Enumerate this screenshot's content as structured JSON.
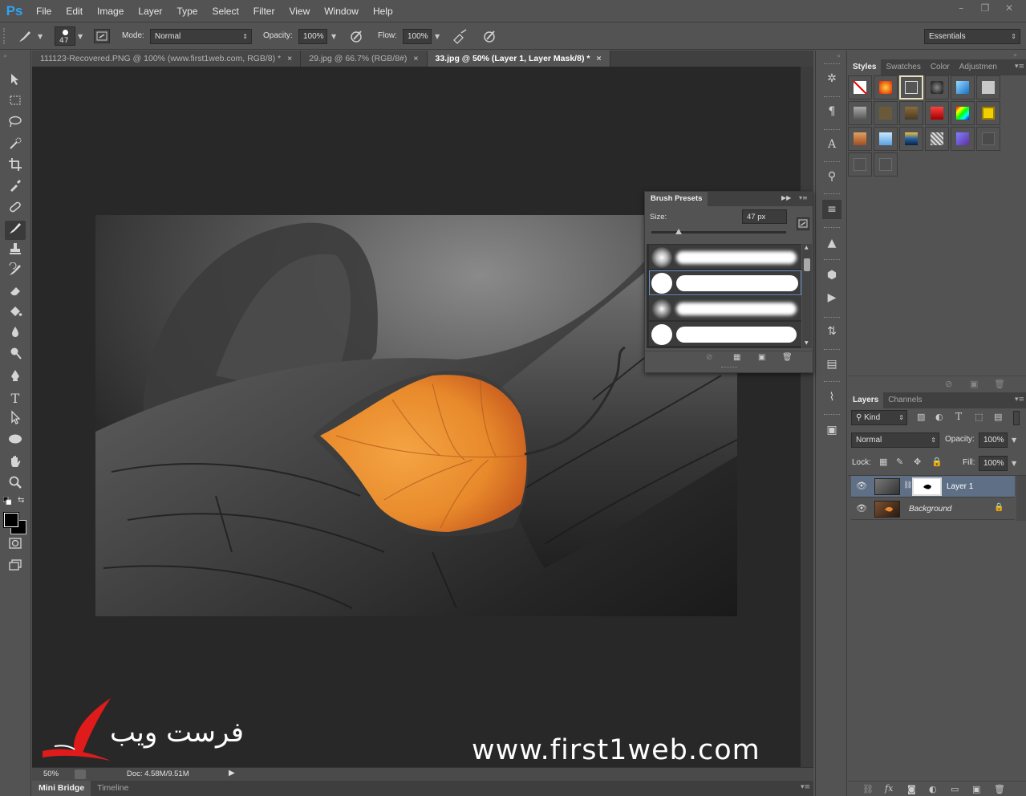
{
  "app": {
    "logo": "Ps",
    "menu": [
      "File",
      "Edit",
      "Image",
      "Layer",
      "Type",
      "Select",
      "Filter",
      "View",
      "Window",
      "Help"
    ],
    "window_controls": [
      "–",
      "❐",
      "✕"
    ]
  },
  "options_bar": {
    "brush_size": "47",
    "mode_label": "Mode:",
    "mode_value": "Normal",
    "opacity_label": "Opacity:",
    "opacity_value": "100%",
    "flow_label": "Flow:",
    "flow_value": "100%",
    "workspace": "Essentials"
  },
  "documents": {
    "tabs": [
      {
        "label": "111123-Recovered.PNG @ 100% (www.first1web.com, RGB/8) *",
        "close": "×"
      },
      {
        "label": "29.jpg @ 66.7% (RGB/8#)",
        "close": "×"
      },
      {
        "label": "33.jpg @ 50% (Layer 1, Layer Mask/8) *",
        "close": "×"
      }
    ]
  },
  "status_bar": {
    "zoom": "50%",
    "doc_info": "Doc: 4.58M/9.51M"
  },
  "bottom_panel": {
    "tabs": [
      "Mini Bridge",
      "Timeline"
    ]
  },
  "styles_panel": {
    "tabs": [
      "Styles",
      "Swatches",
      "Color",
      "Adjustmen"
    ]
  },
  "brush_presets": {
    "title": "Brush Presets",
    "size_label": "Size:",
    "size_value": "47 px",
    "size_fraction": 0.2
  },
  "layers_panel": {
    "tabs": [
      "Layers",
      "Channels"
    ],
    "filter_label": "Kind",
    "blend_mode": "Normal",
    "opacity_label": "Opacity:",
    "opacity_value": "100%",
    "lock_label": "Lock:",
    "fill_label": "Fill:",
    "fill_value": "100%",
    "layers": [
      {
        "name": "Layer 1"
      },
      {
        "name": "Background"
      }
    ]
  },
  "watermark": {
    "url": "www.first1web.com",
    "arabic": "فرست ويب"
  },
  "colors": {
    "ui_bg": "#535353",
    "canvas_bg": "#282828",
    "ps_blue": "#2fa3f6",
    "leaf_orange": "#e88a2c",
    "watermark_red": "#e01b1b"
  }
}
